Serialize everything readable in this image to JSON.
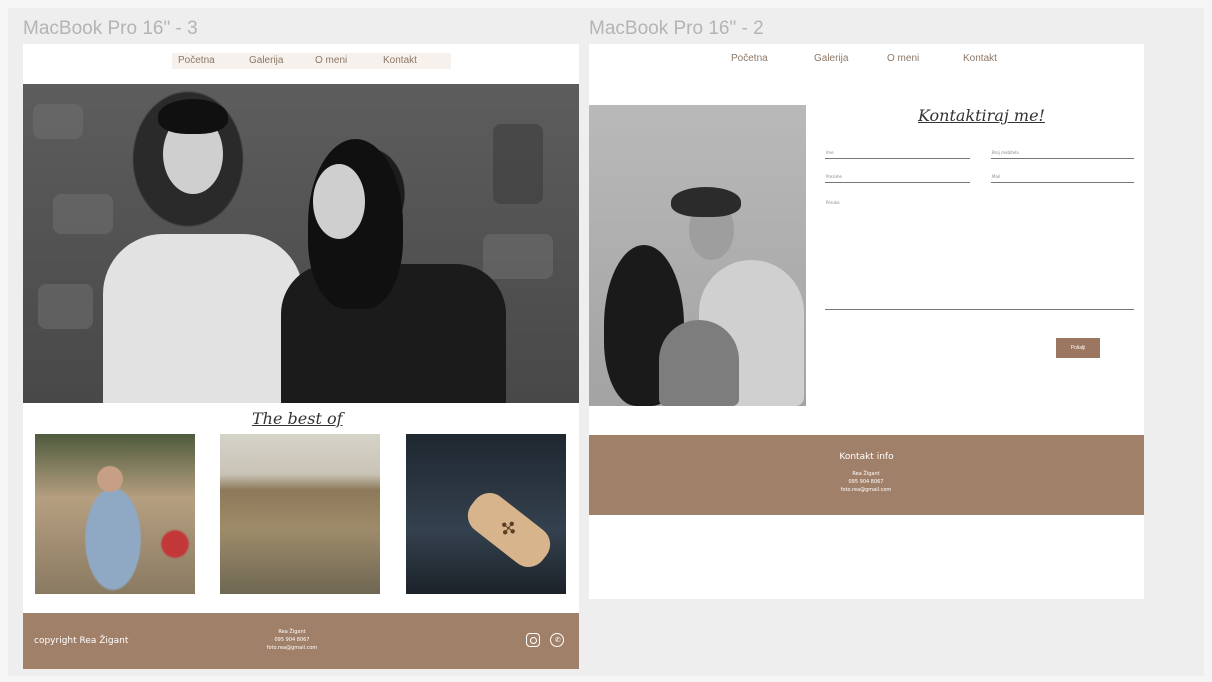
{
  "frames": {
    "left_title": "MacBook Pro 16\" - 3",
    "right_title": "MacBook Pro 16\" - 2"
  },
  "nav": {
    "items": [
      "Početna",
      "Galerija",
      "O meni",
      "Kontakt"
    ]
  },
  "home": {
    "section_title": "The best of",
    "footer": {
      "copyright": "copyright Rea Žigant",
      "contact_lines": [
        "Rea Žigant",
        "095 904 8067",
        "foto.rea@gmail.com"
      ],
      "icons": [
        "instagram-icon",
        "whatsapp-icon"
      ]
    }
  },
  "contact": {
    "title": "Kontaktiraj me!",
    "fields": {
      "first_name": "Ime",
      "last_name": "Prezime",
      "phone": "Broj mobitela",
      "email": "Mail",
      "message": "Poruka"
    },
    "send_label": "Pošalji",
    "footer": {
      "title": "Kontakt info",
      "lines": [
        "Rea Žigant",
        "095 904 8067",
        "foto.rea@gmail.com"
      ]
    }
  },
  "colors": {
    "brand_brown": "#a1806a",
    "button_brown": "#9b7660",
    "nav_bg": "#f6f1ec"
  }
}
